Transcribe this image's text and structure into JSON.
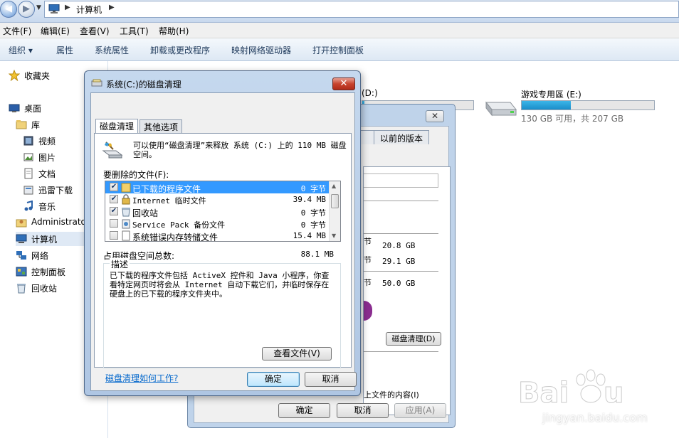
{
  "explorer": {
    "address": {
      "location": "计算机"
    },
    "menu": [
      "文件(F)",
      "编辑(E)",
      "查看(V)",
      "工具(T)",
      "帮助(H)"
    ],
    "toolbar": [
      "组织 ▾",
      "属性",
      "系统属性",
      "卸载或更改程序",
      "映射网络驱动器",
      "打开控制面板"
    ],
    "nav": [
      {
        "label": "收藏夹",
        "icon": "star-icon"
      },
      {
        "label": "桌面",
        "icon": "desktop-icon"
      },
      {
        "label": "库",
        "icon": "library-icon"
      },
      {
        "label": "视频",
        "icon": "video-icon"
      },
      {
        "label": "图片",
        "icon": "pictures-icon"
      },
      {
        "label": "文档",
        "icon": "document-icon"
      },
      {
        "label": "迅雷下载",
        "icon": "download-icon"
      },
      {
        "label": "音乐",
        "icon": "music-icon"
      },
      {
        "label": "Administrato",
        "icon": "user-icon"
      },
      {
        "label": "计算机",
        "icon": "computer-icon",
        "selected": true
      },
      {
        "label": "网络",
        "icon": "network-icon"
      },
      {
        "label": "控制面板",
        "icon": "control-panel-icon"
      },
      {
        "label": "回收站",
        "icon": "recycle-bin-icon"
      }
    ],
    "drives": [
      {
        "label": "(D:)",
        "free_text": "",
        "used_fraction": 0.02
      },
      {
        "label": "游戏专用區 (E:)",
        "free_text": "130 GB 可用，共 207 GB",
        "used_fraction": 0.37
      }
    ]
  },
  "properties_dialog": {
    "close_label": "✕",
    "tab_partial": "",
    "tab_previous_versions": "以前的版本",
    "values": [
      "20.8 GB",
      "29.1 GB",
      "50.0 GB"
    ],
    "value_suffix": "节",
    "cleanup_button": "磁盘清理(D)",
    "compress_text": "上文件的内容(I)",
    "ok": "确定",
    "cancel": "取消",
    "apply": "应用(A)"
  },
  "cleanup_dialog": {
    "title": "系统(C:)的磁盘清理",
    "close_label": "✕",
    "tabs": [
      "磁盘清理",
      "其他选项"
    ],
    "intro": "可以使用“磁盘清理”来释放 系统 (C:) 上的 110 MB 磁盘空间。",
    "files_label": "要删除的文件(F):",
    "files": [
      {
        "name": "已下载的程序文件",
        "size": "0 字节",
        "checked": true,
        "selected": true,
        "icon": "folder-icon"
      },
      {
        "name": "Internet 临时文件",
        "size": "39.4 MB",
        "checked": true,
        "selected": false,
        "icon": "lock-icon"
      },
      {
        "name": "回收站",
        "size": "0 字节",
        "checked": true,
        "selected": false,
        "icon": "recycle-bin-icon"
      },
      {
        "name": "Service Pack 备份文件",
        "size": "0 字节",
        "checked": false,
        "selected": false,
        "icon": "backup-icon"
      },
      {
        "name": "系统错误内存转储文件",
        "size": "15.4 MB",
        "checked": false,
        "selected": false,
        "icon": "file-icon"
      }
    ],
    "total_label": "占用磁盘空间总数:",
    "total_value": "88.1 MB",
    "description_title": "描述",
    "description": "已下载的程序文件包括 ActiveX 控件和 Java 小程序，你查看特定网页时将会从 Internet 自动下载它们，并临时保存在硬盘上的已下载的程序文件夹中。",
    "view_files": "查看文件(V)",
    "help_link": "磁盘清理如何工作?",
    "ok": "确定",
    "cancel": "取消"
  },
  "watermark": {
    "text": "jingyan.baidu.com"
  },
  "colors": {
    "accent": "#3399ff",
    "link": "#0066cc",
    "drive_bar": "#26a0da",
    "close_red": "#c7432e"
  }
}
